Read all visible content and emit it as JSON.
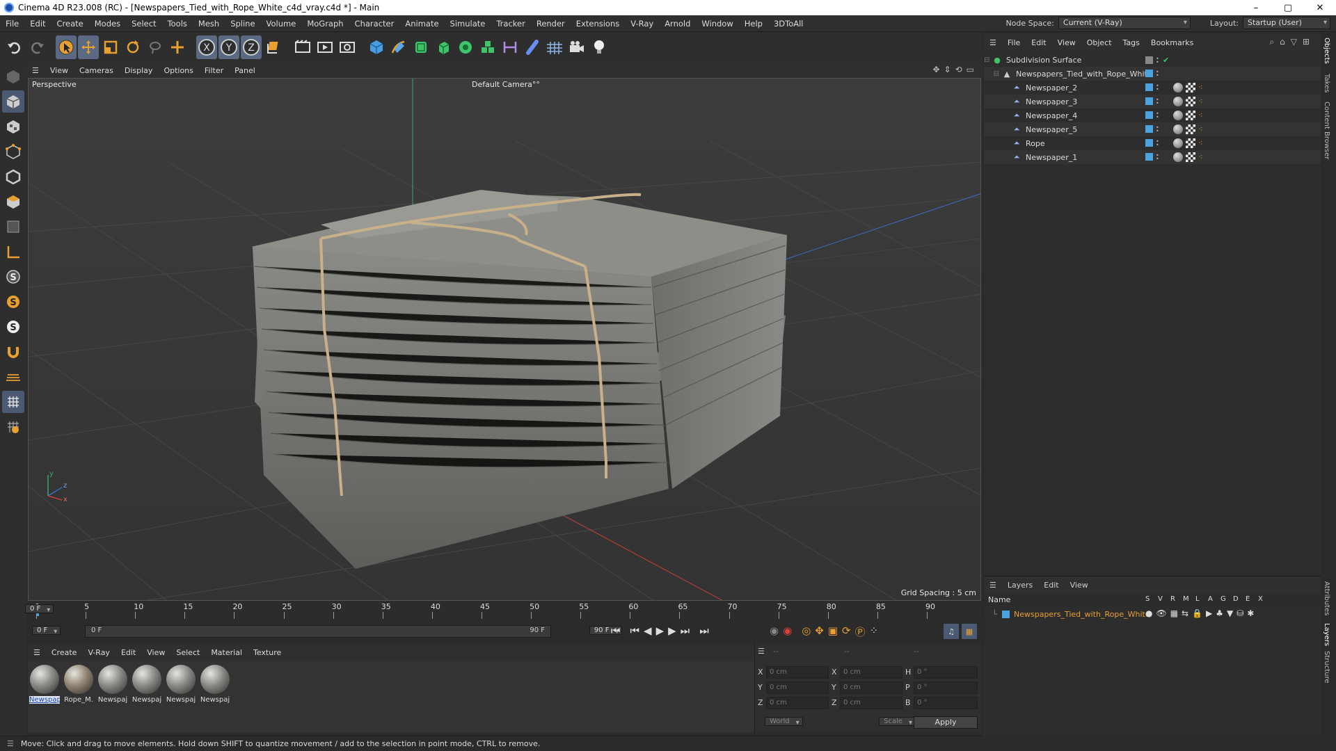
{
  "window": {
    "title": "Cinema 4D R23.008 (RC) - [Newspapers_Tied_with_Rope_White_c4d_vray.c4d *] - Main",
    "buttons": [
      "–",
      "▢",
      "✕"
    ]
  },
  "menubar": {
    "items": [
      "File",
      "Edit",
      "Create",
      "Modes",
      "Select",
      "Tools",
      "Mesh",
      "Spline",
      "Volume",
      "MoGraph",
      "Character",
      "Animate",
      "Simulate",
      "Tracker",
      "Render",
      "Extensions",
      "V-Ray",
      "Arnold",
      "Window",
      "Help",
      "3DToAll"
    ],
    "node_space_label": "Node Space:",
    "node_space_value": "Current (V-Ray)",
    "layout_label": "Layout:",
    "layout_value": "Startup (User)"
  },
  "toolbar": {
    "icons": [
      "undo-icon",
      "redo-icon",
      "select-arrow-icon",
      "move-icon",
      "scale-icon",
      "rotate-icon",
      "lasso-icon",
      "add-icon",
      "x-axis-icon",
      "y-axis-icon",
      "z-axis-icon",
      "coordinate-system-icon",
      "render-region-icon",
      "render-view-icon",
      "render-settings-icon",
      "cube-icon",
      "pen-icon",
      "subdivision-icon",
      "extrude-icon",
      "cloner-icon",
      "mograph-icon",
      "deformer-icon",
      "field-icon",
      "floor-icon",
      "camera-icon",
      "light-icon"
    ],
    "axis_labels": [
      "X",
      "Y",
      "Z"
    ]
  },
  "lefttools": {
    "icons": [
      "make-editable-icon",
      "model-mode-icon",
      "texture-mode-icon",
      "points-mode-icon",
      "edges-mode-icon",
      "polygons-mode-icon",
      "object-axis-icon",
      "workplane-icon",
      "snap-icon",
      "snap-settings-icon",
      "snap-options-icon",
      "magnet-icon",
      "floor-grid-icon",
      "grid-icon",
      "quantize-icon"
    ],
    "glyphs": [
      "S",
      "S",
      "S"
    ]
  },
  "viewport": {
    "menu": [
      "View",
      "Cameras",
      "Display",
      "Options",
      "Filter",
      "Panel"
    ],
    "label": "Perspective",
    "camera": "Default Camera",
    "camera_suffix": "°°",
    "grid_spacing": "Grid Spacing : 5 cm",
    "axis_labels": [
      "y",
      "z",
      "x"
    ]
  },
  "timeline": {
    "ticks": [
      "0",
      "5",
      "10",
      "15",
      "20",
      "25",
      "30",
      "35",
      "40",
      "45",
      "50",
      "55",
      "60",
      "65",
      "70",
      "75",
      "80",
      "85",
      "90"
    ],
    "current_frame": "0 F",
    "start_field": "0 F",
    "range_start": "0 F",
    "range_end": "90 F",
    "end_field": "90 F"
  },
  "materials": {
    "menu": [
      "Create",
      "V-Ray",
      "Edit",
      "View",
      "Select",
      "Material",
      "Texture"
    ],
    "items": [
      {
        "name": "Newspap",
        "color": "#8a8a84"
      },
      {
        "name": "Rope_M.",
        "color": "#8f8270"
      },
      {
        "name": "Newspaj",
        "color": "#888884"
      },
      {
        "name": "Newspaj",
        "color": "#888884"
      },
      {
        "name": "Newspaj",
        "color": "#888884"
      },
      {
        "name": "Newspaj",
        "color": "#888884"
      }
    ]
  },
  "coordinates": {
    "headers": [
      "--",
      "--",
      "--"
    ],
    "rows": [
      {
        "a": "X",
        "av": "0 cm",
        "b": "X",
        "bv": "0 cm",
        "c": "H",
        "cv": "0 °"
      },
      {
        "a": "Y",
        "av": "0 cm",
        "b": "Y",
        "bv": "0 cm",
        "c": "P",
        "cv": "0 °"
      },
      {
        "a": "Z",
        "av": "0 cm",
        "b": "Z",
        "bv": "0 cm",
        "c": "B",
        "cv": "0 °"
      }
    ],
    "mode": "World",
    "scale": "Scale",
    "apply": "Apply"
  },
  "status": {
    "text": "Move: Click and drag to move elements. Hold down SHIFT to quantize movement / add to the selection in point mode, CTRL to remove."
  },
  "objects": {
    "menu": [
      "File",
      "Edit",
      "View",
      "Object",
      "Tags",
      "Bookmarks"
    ],
    "rows": [
      {
        "name": "Subdivision Surface",
        "level": 0
      },
      {
        "name": "Newspapers_Tied_with_Rope_White",
        "level": 1
      },
      {
        "name": "Newspaper_2",
        "level": 2
      },
      {
        "name": "Newspaper_3",
        "level": 2
      },
      {
        "name": "Newspaper_4",
        "level": 2
      },
      {
        "name": "Newspaper_5",
        "level": 2
      },
      {
        "name": "Rope",
        "level": 2
      },
      {
        "name": "Newspaper_1",
        "level": 2
      }
    ]
  },
  "layers": {
    "menu": [
      "Layers",
      "Edit",
      "View"
    ],
    "name_col": "Name",
    "flags": [
      "S",
      "V",
      "R",
      "M",
      "L",
      "A",
      "G",
      "D",
      "E",
      "X"
    ],
    "rows": [
      {
        "name": "Newspapers_Tied_with_Rope_White",
        "color": "#4aa3e0"
      }
    ]
  },
  "right_tabs": [
    "Objects",
    "Takes",
    "Content Browser",
    "Attributes",
    "Layers",
    "Structure"
  ],
  "colors": {
    "accent": "#5b6a82",
    "layer_text": "#e8a030",
    "blue_tag": "#4aa3e0"
  }
}
